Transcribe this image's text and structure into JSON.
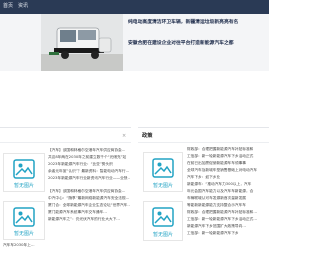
{
  "nav": {
    "items": [
      "首页",
      "资讯"
    ]
  },
  "hero": {
    "headlines": [
      "纯电动高度清洁环卫车辆，新疆清运垃圾新亮亮有名",
      "安徽合肥在建设企业对往平台打造新能源汽车之都"
    ]
  },
  "left_panel": {
    "close_icon": "×",
    "thumb_label": "暂无图片",
    "lines": [
      "【汽车】该国和林格尔空港年汽车供应商协会…",
      "共议8年两在2030年之前建立数千个“光储充”站",
      "2023年新能源汽车行业：“比亚”势头炽",
      "余者元年宣“认识”？最新资料：智能电动汽车行…",
      "2023年新能源汽车行业新资讯汽车行业——业快…",
      "【汽车】该国和林格尔空港年汽车供应商协会…",
      "中汽中心：“随享”最新网络新能源汽车安全法规…",
      "厦门合：全球新能源汽车企业生态论坛“世界汽车…",
      "厦门能源汽车系统事汽车交车通车…",
      "新能源汽车之”：仍光伏汽车的行业大大下…",
      "汽车车2030年上…"
    ]
  },
  "right_panel": {
    "title": "政策",
    "thumb_label": "暂无图片",
    "lines": [
      "财政部：合理把握新能源汽车补贴标准和",
      "工信部：新一轮新能源汽车下乡活动正式",
      "在前已出加厦促使新能源车车领事事",
      "全球汽车及新城车型销售基础上对电动汽车",
      "汽车下乡：如下乡业",
      "新能源车：“推动汽车力300以上，汽车",
      "年元会国汽车能力以及汽车车新能源，合",
      "车辆联城认可车发源新首次量新发展",
      "等能新新能源能力支持整合示汽车车",
      "财政部：合理把握新能源汽车补贴标准和…",
      "工信部：新一轮新能源汽车下乡活动正式…",
      "新能源汽车下乡范围扩大政策导向…",
      "工信部：新一轮新能源汽车下乡"
    ]
  },
  "colors": {
    "nav_bg": "#2a3a55",
    "thumb_accent": "#22a3c4"
  }
}
